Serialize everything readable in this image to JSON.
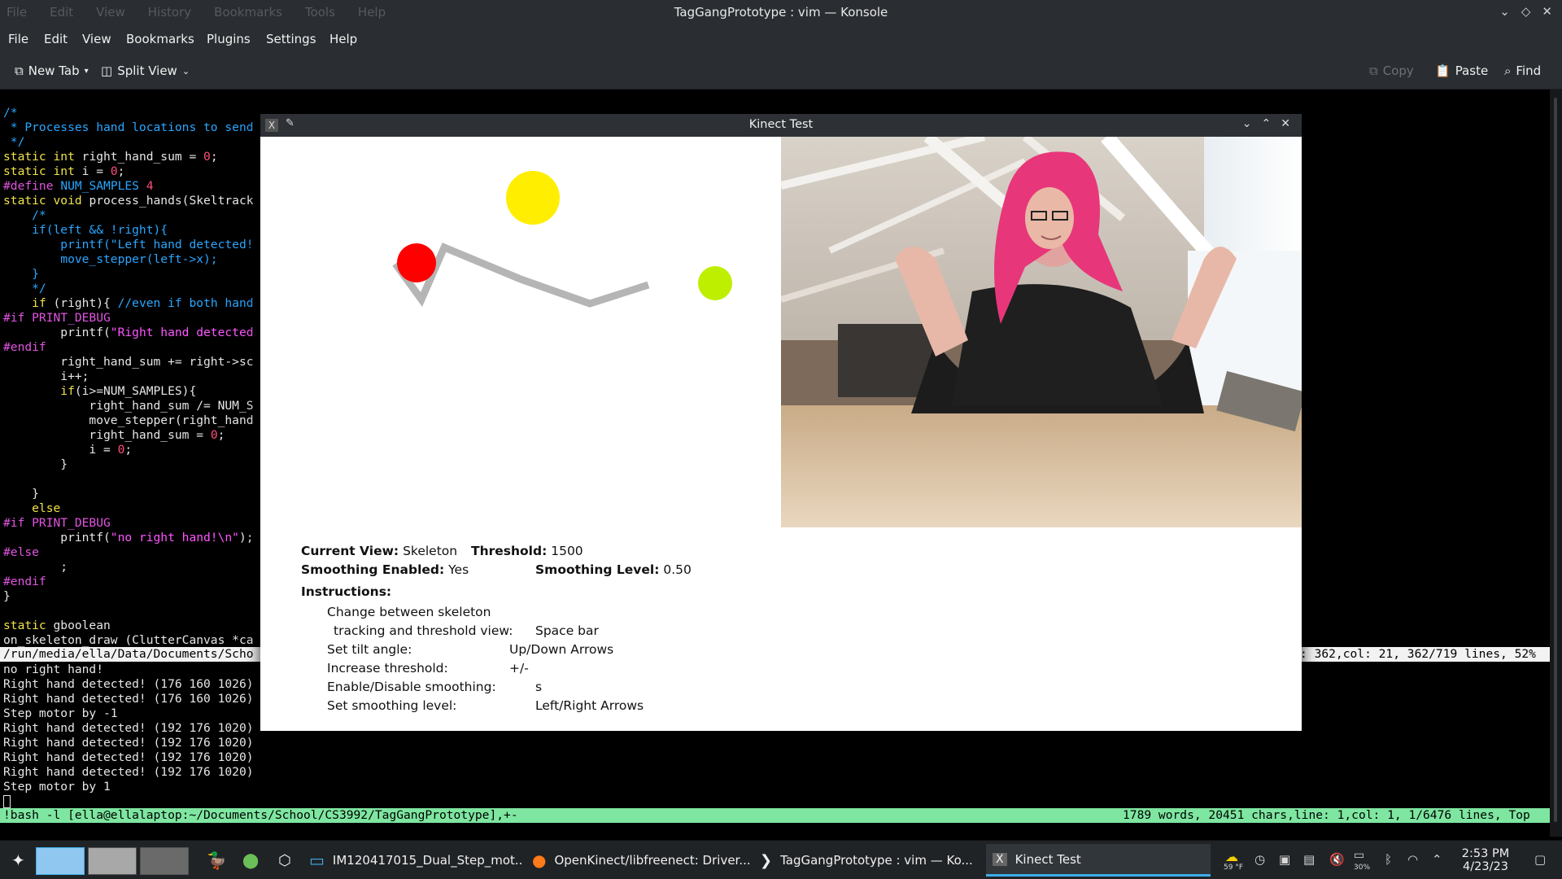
{
  "konsole": {
    "title": "TagGangPrototype : vim — Konsole",
    "ghost_menu": [
      "File",
      "Edit",
      "View",
      "History",
      "Bookmarks",
      "Tools",
      "Help"
    ],
    "menu": [
      "File",
      "Edit",
      "View",
      "Bookmarks",
      "Plugins",
      "Settings",
      "Help"
    ],
    "toolbar": {
      "new_tab": "New Tab",
      "split_view": "Split View",
      "copy": "Copy",
      "paste": "Paste",
      "find": "Find"
    }
  },
  "terminal": {
    "vim_status_left": "/run/media/ella/Data/Documents/Scho",
    "vim_status_right": ": 362,col: 21, 362/719 lines, 52%",
    "output": [
      "no right hand!",
      "Right hand detected! (176 160 1026)",
      "Right hand detected! (176 160 1026)",
      "Step motor by -1",
      "Right hand detected! (192 176 1020)",
      "Right hand detected! (192 176 1020)",
      "Right hand detected! (192 176 1020)",
      "Right hand detected! (192 176 1020)",
      "Step motor by 1"
    ],
    "bash_status_left": "!bash -l [ella@ellalaptop:~/Documents/School/CS3992/TagGangPrototype],+-",
    "bash_status_right": "1789 words, 20451 chars,line: 1,col: 1, 1/6476 lines, Top"
  },
  "kinect": {
    "title": "Kinect Test",
    "current_view_label": "Current View:",
    "current_view_value": "Skeleton",
    "threshold_label": "Threshold:",
    "threshold_value": "1500",
    "smoothing_enabled_label": "Smoothing Enabled:",
    "smoothing_enabled_value": "Yes",
    "smoothing_level_label": "Smoothing Level:",
    "smoothing_level_value": "0.50",
    "instructions_label": "Instructions:",
    "instructions": [
      {
        "action": "Change between skeleton",
        "key": ""
      },
      {
        "action": "tracking and threshold view:",
        "key": "Space bar"
      },
      {
        "action": "Set tilt angle:",
        "key": "Up/Down Arrows"
      },
      {
        "action": "Increase threshold:",
        "key": "+/-"
      },
      {
        "action": "Enable/Disable smoothing:",
        "key": "s"
      },
      {
        "action": "Set smoothing level:",
        "key": "Left/Right Arrows"
      }
    ],
    "colors": {
      "head": "#ffee00",
      "left_hand": "#ff0000",
      "right_hand": "#bfef00",
      "bone": "#b5b5b5"
    }
  },
  "taskbar": {
    "tasks": [
      "IM120417015_Dual_Step_mot...",
      "OpenKinect/libfreenect: Driver...",
      "TagGangPrototype : vim — Ko...",
      "Kinect Test"
    ],
    "temperature": "59 °F",
    "battery": "30%",
    "time": "2:53 PM",
    "date": "4/23/23"
  }
}
